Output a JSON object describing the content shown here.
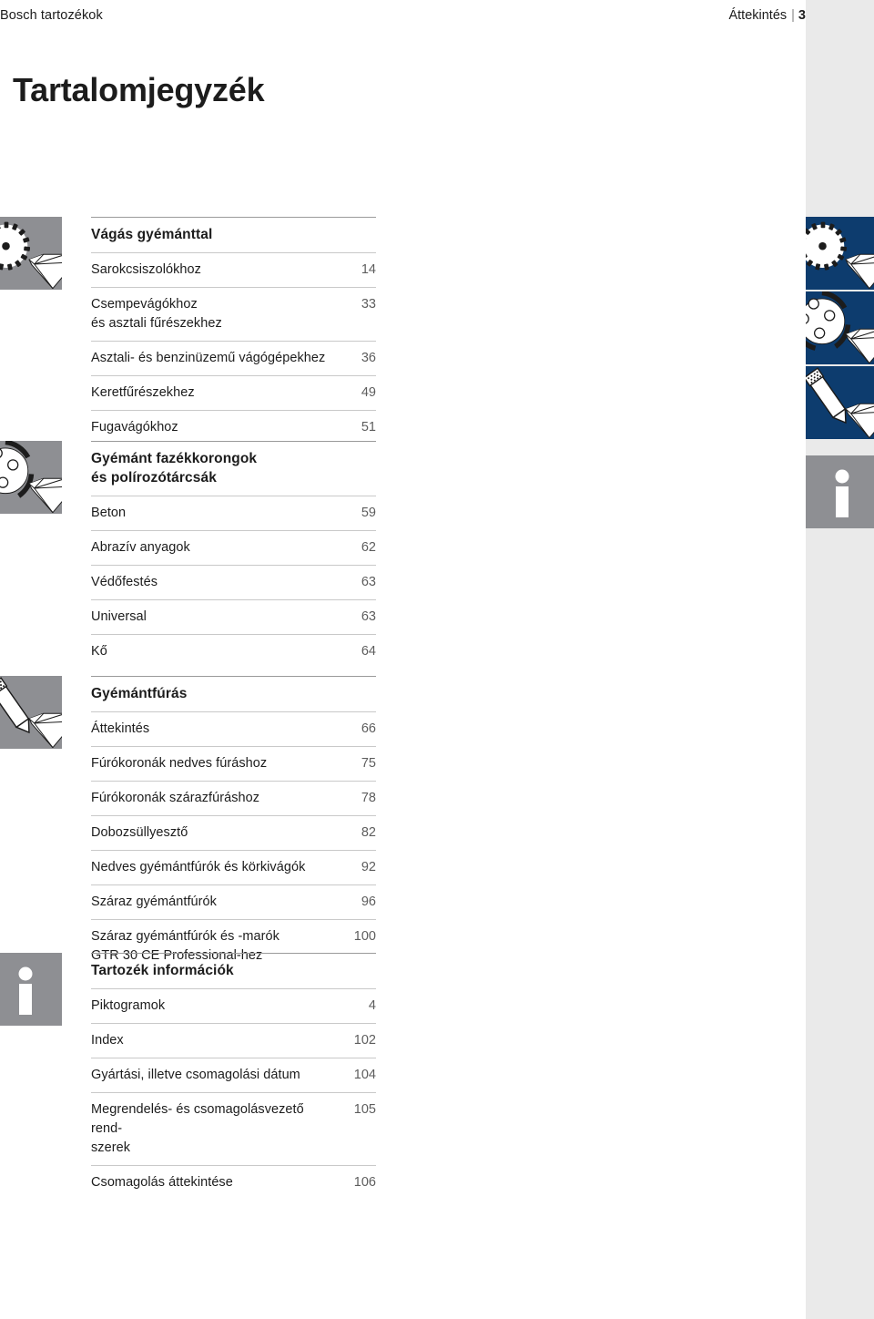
{
  "header": {
    "left_text": "Bosch tartozékok",
    "right_text": "Áttekintés",
    "separator": "|",
    "page_number": "3"
  },
  "title": "Tartalomjegyzék",
  "colors": {
    "brand_blue": "#0d3c6e",
    "tile_gray": "#8e8f93",
    "bleed_gray": "#eaeaea",
    "rule_gray": "#c9c9c9",
    "text": "#1c1c1c",
    "page_number_gray": "#5d5d5d"
  },
  "sections": [
    {
      "title": "Vágás gyémánttal",
      "icon": "diamond-saw-blade-icon",
      "rows": [
        {
          "label": "Sarokcsiszolókhoz",
          "page": "14"
        },
        {
          "label": "Csempevágókhoz\nés asztali fűrészekhez",
          "page": "33"
        },
        {
          "label": "Asztali- és benzinüzemű vágógépekhez",
          "page": "36"
        },
        {
          "label": "Keretfűrészekhez",
          "page": "49"
        },
        {
          "label": "Fugavágókhoz",
          "page": "51"
        }
      ]
    },
    {
      "title": "Gyémánt fazékkorongok\nés polírozótárcsák",
      "icon": "diamond-cup-wheel-icon",
      "rows": [
        {
          "label": "Beton",
          "page": "59"
        },
        {
          "label": "Abrazív anyagok",
          "page": "62"
        },
        {
          "label": "Védőfestés",
          "page": "63"
        },
        {
          "label": "Universal",
          "page": "63"
        },
        {
          "label": "Kő",
          "page": "64"
        }
      ]
    },
    {
      "title": "Gyémántfúrás",
      "icon": "diamond-core-bit-icon",
      "rows": [
        {
          "label": "Áttekintés",
          "page": "66"
        },
        {
          "label": "Fúrókoronák nedves fúráshoz",
          "page": "75"
        },
        {
          "label": "Fúrókoronák szárazfúráshoz",
          "page": "78"
        },
        {
          "label": "Dobozsüllyesztő",
          "page": "82"
        },
        {
          "label": "Nedves gyémántfúrók és körkivágók",
          "page": "92"
        },
        {
          "label": "Száraz gyémántfúrók",
          "page": "96"
        },
        {
          "label": "Száraz gyémántfúrók és -marók\nGTR 30 CE Professional-hez",
          "page": "100"
        }
      ]
    },
    {
      "title": "Tartozék információk",
      "icon": "info-icon",
      "rows": [
        {
          "label": "Piktogramok",
          "page": "4"
        },
        {
          "label": "Index",
          "page": "102"
        },
        {
          "label": "Gyártási, illetve csomagolási dátum",
          "page": "104"
        },
        {
          "label": "Megrendelés- és csomagolásvezető rend-\nszerek",
          "page": "105"
        },
        {
          "label": "Csomagolás áttekintése",
          "page": "106"
        }
      ]
    }
  ]
}
